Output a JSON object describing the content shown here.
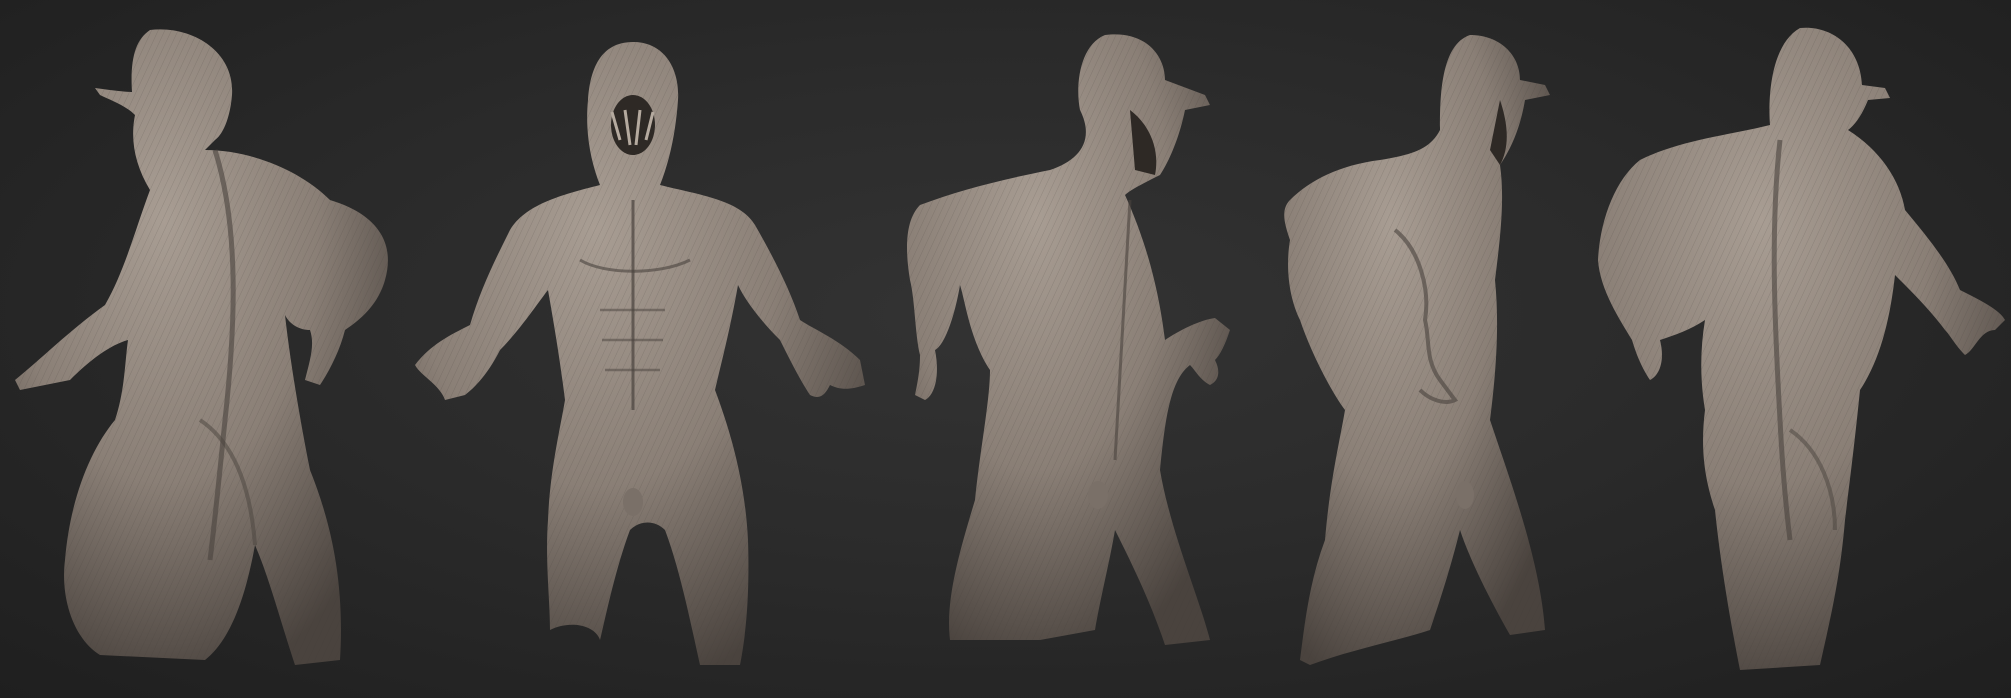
{
  "scene": {
    "kind": "3d-sculpt-turnaround",
    "view_count": 5,
    "views": [
      {
        "name": "back-left-three-quarter"
      },
      {
        "name": "front"
      },
      {
        "name": "front-right-three-quarter"
      },
      {
        "name": "right-profile"
      },
      {
        "name": "back-right-three-quarter"
      }
    ]
  },
  "colors": {
    "background": "#2a2a2a",
    "clay_base": "#8a7f76",
    "clay_highlight": "#a89d93",
    "clay_shadow": "#4a433e"
  }
}
